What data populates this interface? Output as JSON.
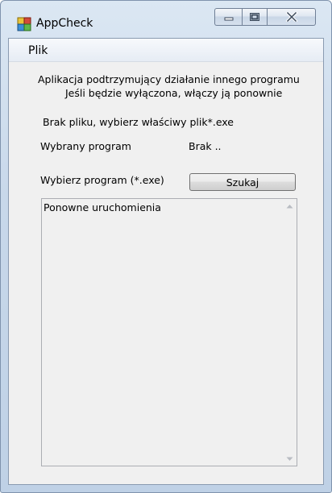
{
  "window": {
    "title": "AppCheck",
    "app_icon": "appcheck-icon",
    "controls": {
      "minimize": "minimize-icon",
      "maximize": "maximize-icon",
      "close": "close-icon"
    }
  },
  "menu": {
    "items": [
      {
        "label": "Plik"
      }
    ]
  },
  "main": {
    "description_line1": "Aplikacja podtrzymujący działanie innego programu",
    "description_line2": "Jeśli będzie wyłączona, włączy ją ponownie",
    "status_text": "Brak pliku, wybierz właściwy plik*.exe",
    "selected_program_label": "Wybrany program",
    "selected_program_value": "Brak ..",
    "choose_program_label": "Wybierz program (*.exe)",
    "search_button_label": "Szukaj",
    "log_text": "Ponowne uruchomienia"
  }
}
